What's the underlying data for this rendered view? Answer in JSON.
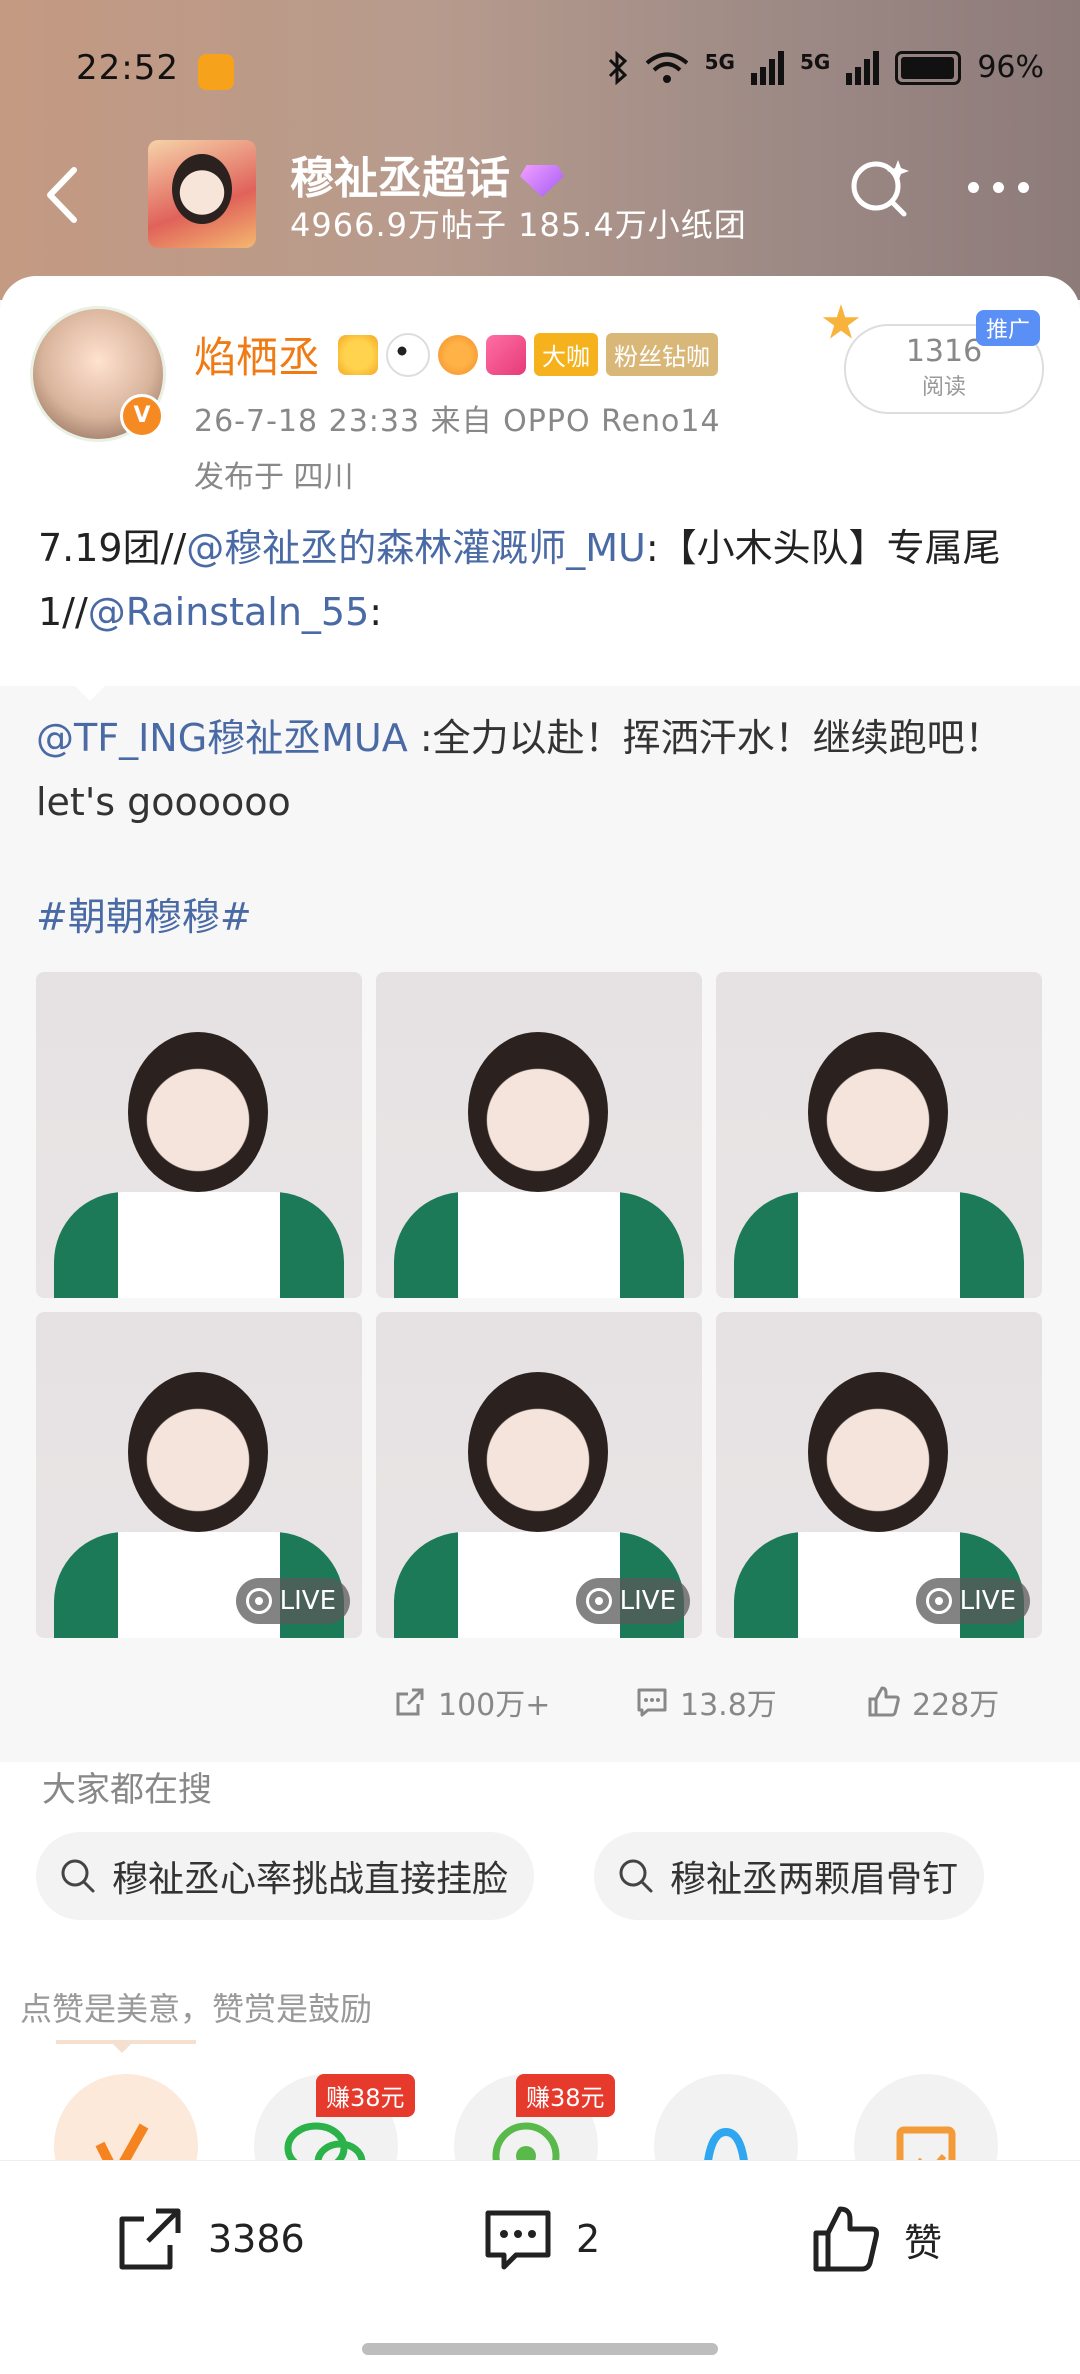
{
  "status_bar": {
    "time": "22:52",
    "battery": "96%",
    "network": "5G"
  },
  "header": {
    "group_name": "穆祉丞超话",
    "stats": "4966.9万帖子 185.4万小纸团"
  },
  "post": {
    "author": "焰栖丞",
    "tag_big": "大咖",
    "tag_fan": "粉丝钻咖",
    "meta": "26-7-18 23:33  来自 OPPO Reno14",
    "location": "发布于 四川",
    "reads_count": "1316",
    "reads_label": "阅读",
    "promo": "推广",
    "text_prefix": "7.19团//",
    "mention_1": "@穆祉丞的森林灌溉师_MU",
    "text_mid": ":【小木头队】专属尾1//",
    "mention_2": "@Rainstaln_55",
    "text_end": ":"
  },
  "repost": {
    "mention": "@TF_ING穆祉丞MUA",
    "text": " :全力以赴！挥洒汗水！继续跑吧！let's goooooo",
    "topic": "#朝朝穆穆#",
    "live_label": "LIVE",
    "shares": "100万+",
    "comments": "13.8万",
    "likes": "228万"
  },
  "search": {
    "title": "大家都在搜",
    "chip_1": "穆祉丞心率挑战直接挂脸",
    "chip_2": "穆祉丞两颗眉骨钉"
  },
  "reward": {
    "title": "点赞是美意，赞赏是鼓励",
    "earn_1": "赚38元",
    "earn_2": "赚38元"
  },
  "bottom": {
    "share_count": "3386",
    "comment_count": "2",
    "like_label": "赞"
  }
}
